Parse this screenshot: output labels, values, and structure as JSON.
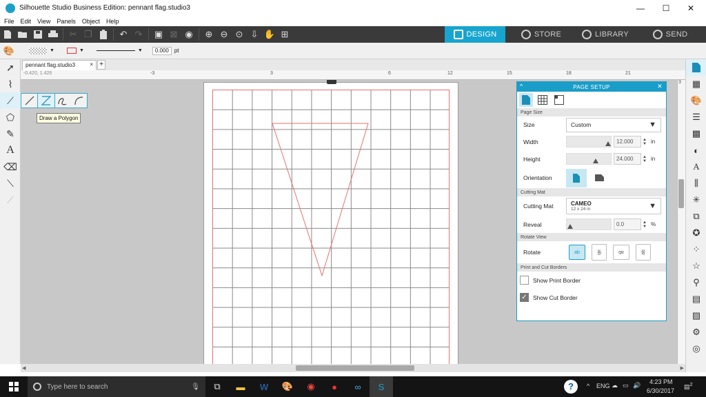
{
  "window": {
    "title": "Silhouette Studio Business Edition: pennant flag.studio3",
    "min": "—",
    "max": "☐",
    "close": "✕"
  },
  "menu": [
    "File",
    "Edit",
    "View",
    "Panels",
    "Object",
    "Help"
  ],
  "nav_tabs": [
    {
      "label": "DESIGN",
      "active": true
    },
    {
      "label": "STORE",
      "active": false
    },
    {
      "label": "LIBRARY",
      "active": false
    },
    {
      "label": "SEND",
      "active": false
    }
  ],
  "propbar": {
    "line_width": "0.000",
    "unit": "pt"
  },
  "document_tab": {
    "name": "pennant flag.studio3",
    "close": "×",
    "add": "+"
  },
  "ruler": {
    "coords": "-0.420, 1.426",
    "h_labels": [
      "-3",
      "3",
      "6",
      "12",
      "15",
      "18",
      "21"
    ],
    "v_labels": [
      "3"
    ]
  },
  "tooltip": "Draw a Polygon",
  "colors": {
    "accent": "#17a5cf",
    "toolbar": "#3a3a3a",
    "cut_line": "#e87070"
  },
  "page_setup": {
    "title": "PAGE SETUP",
    "sections": {
      "page_size": "Page Size",
      "cutting_mat": "Cutting Mat",
      "rotate_view": "Rotate View",
      "borders": "Print and Cut Borders"
    },
    "size_label": "Size",
    "size_value": "Custom",
    "width_label": "Width",
    "width_value": "12.000",
    "width_unit": "in",
    "height_label": "Height",
    "height_value": "24.000",
    "height_unit": "in",
    "orientation_label": "Orientation",
    "cutting_mat_label": "Cutting Mat",
    "cutting_mat_value": "CAMEO",
    "cutting_mat_sub": "12 x 24 in",
    "reveal_label": "Reveal",
    "reveal_value": "0.0",
    "reveal_unit": "%",
    "rotate_label": "Rotate",
    "rotate_options": [
      "ab",
      "ab",
      "ab",
      "ab"
    ],
    "show_print_border": {
      "label": "Show Print Border",
      "checked": false
    },
    "show_cut_border": {
      "label": "Show Cut Border",
      "checked": true
    }
  },
  "taskbar": {
    "search_placeholder": "Type here to search",
    "time": "4:23 PM",
    "date": "6/30/2017",
    "lang": "ENG",
    "notifications": "2"
  }
}
